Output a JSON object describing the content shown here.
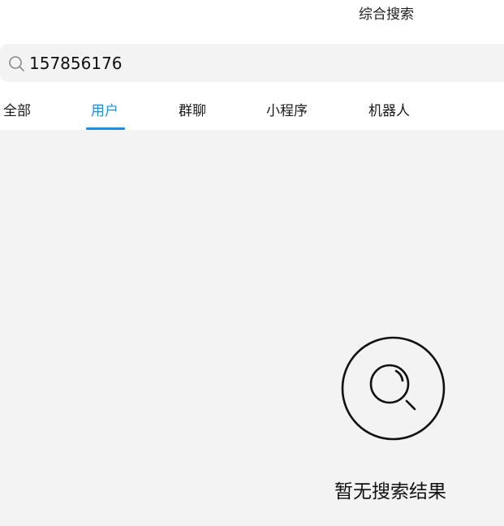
{
  "header": {
    "title": "综合搜索"
  },
  "search": {
    "value": "157856176",
    "icon": "search-icon"
  },
  "tabs": [
    {
      "label": "全部",
      "active": false
    },
    {
      "label": "用户",
      "active": true
    },
    {
      "label": "群聊",
      "active": false
    },
    {
      "label": "小程序",
      "active": false
    },
    {
      "label": "机器人",
      "active": false
    }
  ],
  "empty_state": {
    "icon": "empty-search-icon",
    "message": "暂无搜索结果"
  },
  "colors": {
    "accent": "#1a8fe8",
    "background": "#f3f3f3",
    "text": "#1a1a1a"
  }
}
